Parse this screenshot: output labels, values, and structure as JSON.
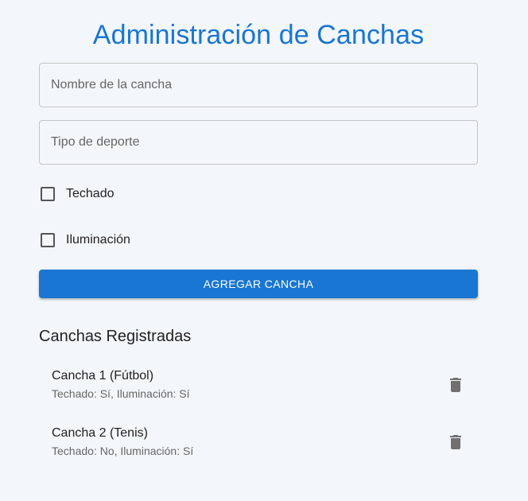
{
  "header": {
    "title": "Administración de Canchas"
  },
  "form": {
    "nombre_placeholder": "Nombre de la cancha",
    "nombre_value": "",
    "tipo_placeholder": "Tipo de deporte",
    "tipo_value": "",
    "techado_label": "Techado",
    "techado_checked": false,
    "iluminacion_label": "Iluminación",
    "iluminacion_checked": false,
    "submit_label": "AGREGAR CANCHA"
  },
  "list": {
    "title": "Canchas Registradas",
    "items": [
      {
        "primary": "Cancha 1 (Fútbol)",
        "secondary": "Techado: Sí, Iluminación: Sí",
        "delete_icon": "trash-icon"
      },
      {
        "primary": "Cancha 2 (Tenis)",
        "secondary": "Techado: No, Iluminación: Sí",
        "delete_icon": "trash-icon"
      }
    ]
  },
  "colors": {
    "accent": "#1976d2",
    "background": "#f3f6fa",
    "icon": "#707070"
  }
}
